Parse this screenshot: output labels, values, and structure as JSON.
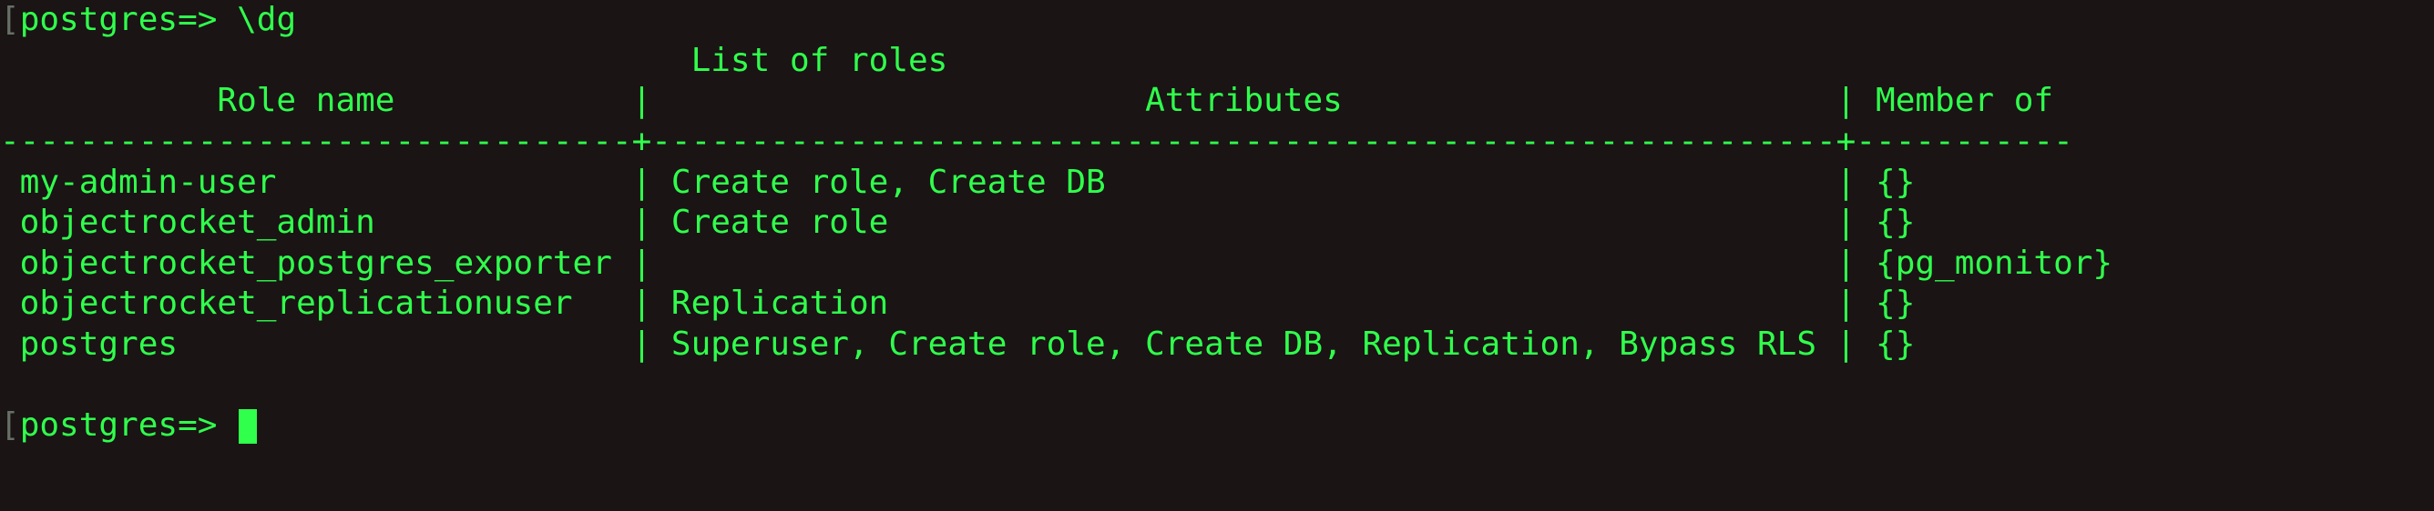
{
  "prompt1_bracket": "[",
  "prompt1_text": "postgres=> ",
  "command": "\\dg",
  "title_line": "                                   List of roles",
  "header_line": "           Role name            |                         Attributes                         | Member of",
  "divider_line": "--------------------------------+------------------------------------------------------------+-----------",
  "row1": " my-admin-user                  | Create role, Create DB                                     | {}",
  "row2": " objectrocket_admin             | Create role                                                | {}",
  "row3": " objectrocket_postgres_exporter |                                                            | {pg_monitor}",
  "row4": " objectrocket_replicationuser   | Replication                                                | {}",
  "row5": " postgres                       | Superuser, Create role, Create DB, Replication, Bypass RLS | {}",
  "blank": "",
  "prompt2_bracket": "[",
  "prompt2_text": "postgres=> ",
  "chart_data": {
    "type": "table",
    "title": "List of roles",
    "columns": [
      "Role name",
      "Attributes",
      "Member of"
    ],
    "rows": [
      {
        "Role name": "my-admin-user",
        "Attributes": "Create role, Create DB",
        "Member of": "{}"
      },
      {
        "Role name": "objectrocket_admin",
        "Attributes": "Create role",
        "Member of": "{}"
      },
      {
        "Role name": "objectrocket_postgres_exporter",
        "Attributes": "",
        "Member of": "{pg_monitor}"
      },
      {
        "Role name": "objectrocket_replicationuser",
        "Attributes": "Replication",
        "Member of": "{}"
      },
      {
        "Role name": "postgres",
        "Attributes": "Superuser, Create role, Create DB, Replication, Bypass RLS",
        "Member of": "{}"
      }
    ]
  }
}
